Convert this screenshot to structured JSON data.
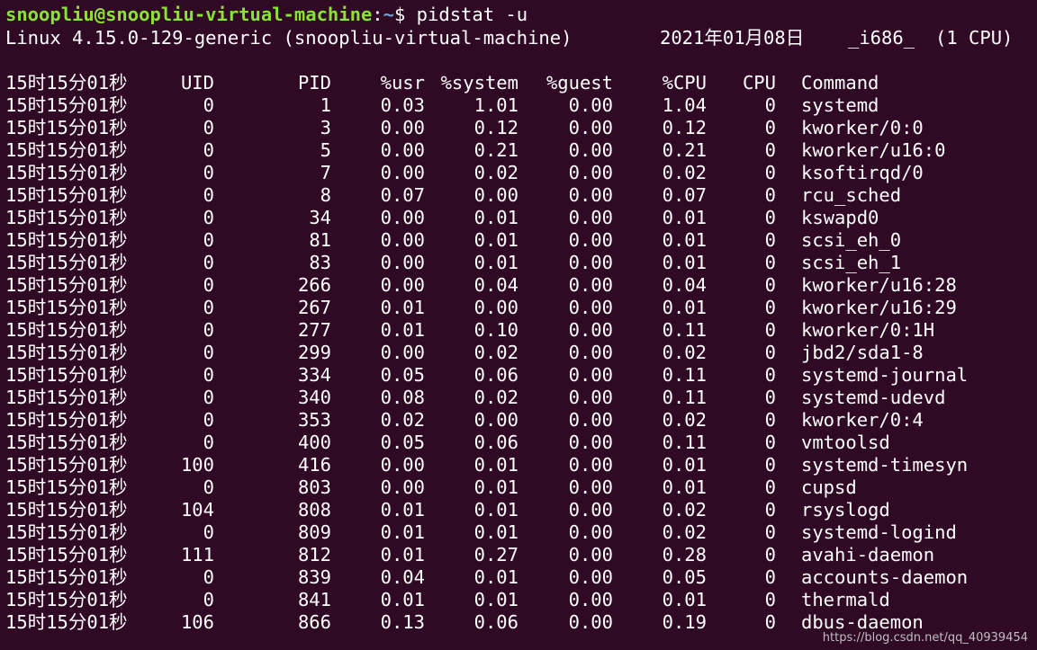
{
  "prompt": {
    "user_host": "snoopliu@snoopliu-virtual-machine",
    "sep": ":",
    "path": "~",
    "dollar": "$ ",
    "command": "pidstat -u"
  },
  "sysinfo": {
    "kernel": "Linux 4.15.0-129-generic (snoopliu-virtual-machine)",
    "date": "2021年01月08日",
    "arch": "_i686_",
    "cpus": "(1 CPU)"
  },
  "table": {
    "headers": [
      "15时15分01秒",
      "UID",
      "PID",
      "%usr",
      "%system",
      "%guest",
      "%CPU",
      "CPU",
      "Command"
    ],
    "rows": [
      [
        "15时15分01秒",
        "0",
        "1",
        "0.03",
        "1.01",
        "0.00",
        "1.04",
        "0",
        "systemd"
      ],
      [
        "15时15分01秒",
        "0",
        "3",
        "0.00",
        "0.12",
        "0.00",
        "0.12",
        "0",
        "kworker/0:0"
      ],
      [
        "15时15分01秒",
        "0",
        "5",
        "0.00",
        "0.21",
        "0.00",
        "0.21",
        "0",
        "kworker/u16:0"
      ],
      [
        "15时15分01秒",
        "0",
        "7",
        "0.00",
        "0.02",
        "0.00",
        "0.02",
        "0",
        "ksoftirqd/0"
      ],
      [
        "15时15分01秒",
        "0",
        "8",
        "0.07",
        "0.00",
        "0.00",
        "0.07",
        "0",
        "rcu_sched"
      ],
      [
        "15时15分01秒",
        "0",
        "34",
        "0.00",
        "0.01",
        "0.00",
        "0.01",
        "0",
        "kswapd0"
      ],
      [
        "15时15分01秒",
        "0",
        "81",
        "0.00",
        "0.01",
        "0.00",
        "0.01",
        "0",
        "scsi_eh_0"
      ],
      [
        "15时15分01秒",
        "0",
        "83",
        "0.00",
        "0.01",
        "0.00",
        "0.01",
        "0",
        "scsi_eh_1"
      ],
      [
        "15时15分01秒",
        "0",
        "266",
        "0.00",
        "0.04",
        "0.00",
        "0.04",
        "0",
        "kworker/u16:28"
      ],
      [
        "15时15分01秒",
        "0",
        "267",
        "0.01",
        "0.00",
        "0.00",
        "0.01",
        "0",
        "kworker/u16:29"
      ],
      [
        "15时15分01秒",
        "0",
        "277",
        "0.01",
        "0.10",
        "0.00",
        "0.11",
        "0",
        "kworker/0:1H"
      ],
      [
        "15时15分01秒",
        "0",
        "299",
        "0.00",
        "0.02",
        "0.00",
        "0.02",
        "0",
        "jbd2/sda1-8"
      ],
      [
        "15时15分01秒",
        "0",
        "334",
        "0.05",
        "0.06",
        "0.00",
        "0.11",
        "0",
        "systemd-journal"
      ],
      [
        "15时15分01秒",
        "0",
        "340",
        "0.08",
        "0.02",
        "0.00",
        "0.11",
        "0",
        "systemd-udevd"
      ],
      [
        "15时15分01秒",
        "0",
        "353",
        "0.02",
        "0.00",
        "0.00",
        "0.02",
        "0",
        "kworker/0:4"
      ],
      [
        "15时15分01秒",
        "0",
        "400",
        "0.05",
        "0.06",
        "0.00",
        "0.11",
        "0",
        "vmtoolsd"
      ],
      [
        "15时15分01秒",
        "100",
        "416",
        "0.00",
        "0.01",
        "0.00",
        "0.01",
        "0",
        "systemd-timesyn"
      ],
      [
        "15时15分01秒",
        "0",
        "803",
        "0.00",
        "0.01",
        "0.00",
        "0.01",
        "0",
        "cupsd"
      ],
      [
        "15时15分01秒",
        "104",
        "808",
        "0.01",
        "0.01",
        "0.00",
        "0.02",
        "0",
        "rsyslogd"
      ],
      [
        "15时15分01秒",
        "0",
        "809",
        "0.01",
        "0.01",
        "0.00",
        "0.02",
        "0",
        "systemd-logind"
      ],
      [
        "15时15分01秒",
        "111",
        "812",
        "0.01",
        "0.27",
        "0.00",
        "0.28",
        "0",
        "avahi-daemon"
      ],
      [
        "15时15分01秒",
        "0",
        "839",
        "0.04",
        "0.01",
        "0.00",
        "0.05",
        "0",
        "accounts-daemon"
      ],
      [
        "15时15分01秒",
        "0",
        "841",
        "0.01",
        "0.01",
        "0.00",
        "0.01",
        "0",
        "thermald"
      ],
      [
        "15时15分01秒",
        "106",
        "866",
        "0.13",
        "0.06",
        "0.00",
        "0.19",
        "0",
        "dbus-daemon"
      ]
    ]
  },
  "watermark": "https://blog.csdn.net/qq_40939454",
  "colors": {
    "background": "#300a24",
    "text": "#ffffff",
    "prompt_user": "#8ae234",
    "prompt_path": "#729fcf"
  }
}
